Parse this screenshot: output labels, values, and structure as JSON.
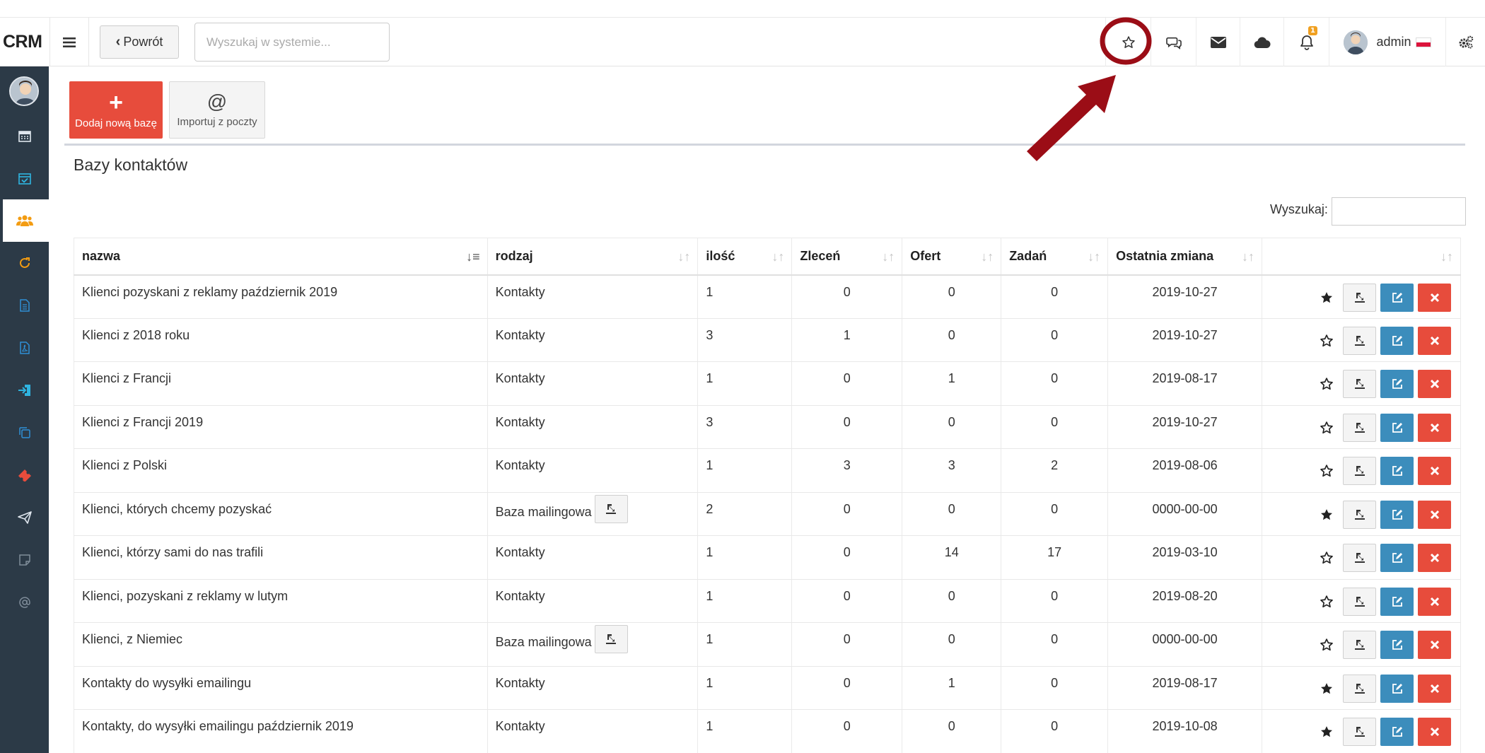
{
  "header": {
    "logo": "CRM",
    "back_label": "Powrót",
    "search_placeholder": "Wyszukaj w systemie...",
    "notification_count": "1",
    "user_name": "admin"
  },
  "toolbar": {
    "add_label": "Dodaj nową bazę",
    "import_label": "Importuj z poczty"
  },
  "panel": {
    "title": "Bazy kontaktów",
    "search_label": "Wyszukaj:"
  },
  "table": {
    "columns": [
      "nazwa",
      "rodzaj",
      "ilość",
      "Zleceń",
      "Ofert",
      "Zadań",
      "Ostatnia zmiana",
      ""
    ],
    "rows": [
      {
        "name": "Klienci pozyskani z reklamy październik 2019",
        "type": "Kontakty",
        "count": "1",
        "orders": "0",
        "offers": "0",
        "tasks": "0",
        "changed": "2019-10-27",
        "starred": true,
        "mailing": false
      },
      {
        "name": "Klienci z 2018 roku",
        "type": "Kontakty",
        "count": "3",
        "orders": "1",
        "offers": "0",
        "tasks": "0",
        "changed": "2019-10-27",
        "starred": false,
        "mailing": false
      },
      {
        "name": "Klienci z Francji",
        "type": "Kontakty",
        "count": "1",
        "orders": "0",
        "offers": "1",
        "tasks": "0",
        "changed": "2019-08-17",
        "starred": false,
        "mailing": false
      },
      {
        "name": "Klienci z Francji 2019",
        "type": "Kontakty",
        "count": "3",
        "orders": "0",
        "offers": "0",
        "tasks": "0",
        "changed": "2019-10-27",
        "starred": false,
        "mailing": false
      },
      {
        "name": "Klienci z Polski",
        "type": "Kontakty",
        "count": "1",
        "orders": "3",
        "offers": "3",
        "tasks": "2",
        "changed": "2019-08-06",
        "starred": false,
        "mailing": false
      },
      {
        "name": "Klienci, których chcemy pozyskać",
        "type": "Baza mailingowa",
        "count": "2",
        "orders": "0",
        "offers": "0",
        "tasks": "0",
        "changed": "0000-00-00",
        "starred": true,
        "mailing": true
      },
      {
        "name": "Klienci, którzy sami do nas trafili",
        "type": "Kontakty",
        "count": "1",
        "orders": "0",
        "offers": "14",
        "tasks": "17",
        "changed": "2019-03-10",
        "starred": false,
        "mailing": false
      },
      {
        "name": "Klienci, pozyskani z reklamy w lutym",
        "type": "Kontakty",
        "count": "1",
        "orders": "0",
        "offers": "0",
        "tasks": "0",
        "changed": "2019-08-20",
        "starred": false,
        "mailing": false
      },
      {
        "name": "Klienci, z Niemiec",
        "type": "Baza mailingowa",
        "count": "1",
        "orders": "0",
        "offers": "0",
        "tasks": "0",
        "changed": "0000-00-00",
        "starred": false,
        "mailing": true
      },
      {
        "name": "Kontakty do wysyłki emailingu",
        "type": "Kontakty",
        "count": "1",
        "orders": "0",
        "offers": "1",
        "tasks": "0",
        "changed": "2019-08-17",
        "starred": true,
        "mailing": false
      },
      {
        "name": "Kontakty, do wysyłki emailingu październik 2019",
        "type": "Kontakty",
        "count": "1",
        "orders": "0",
        "offers": "0",
        "tasks": "0",
        "changed": "2019-10-08",
        "starred": true,
        "mailing": false
      }
    ]
  },
  "sidebar": {
    "items": [
      "calendar-icon",
      "calendar-check-icon",
      "users-icon",
      "refresh-icon",
      "document-icon",
      "pdf-icon",
      "sign-in-icon",
      "copy-icon",
      "ticket-icon",
      "send-icon",
      "note-icon",
      "at-icon"
    ],
    "active_index": 2
  },
  "colors": {
    "sidebar": "#2c3a47",
    "primary_red": "#e74c3c",
    "edit_blue": "#3c8dbc",
    "annotation_red": "#9b0d16"
  }
}
